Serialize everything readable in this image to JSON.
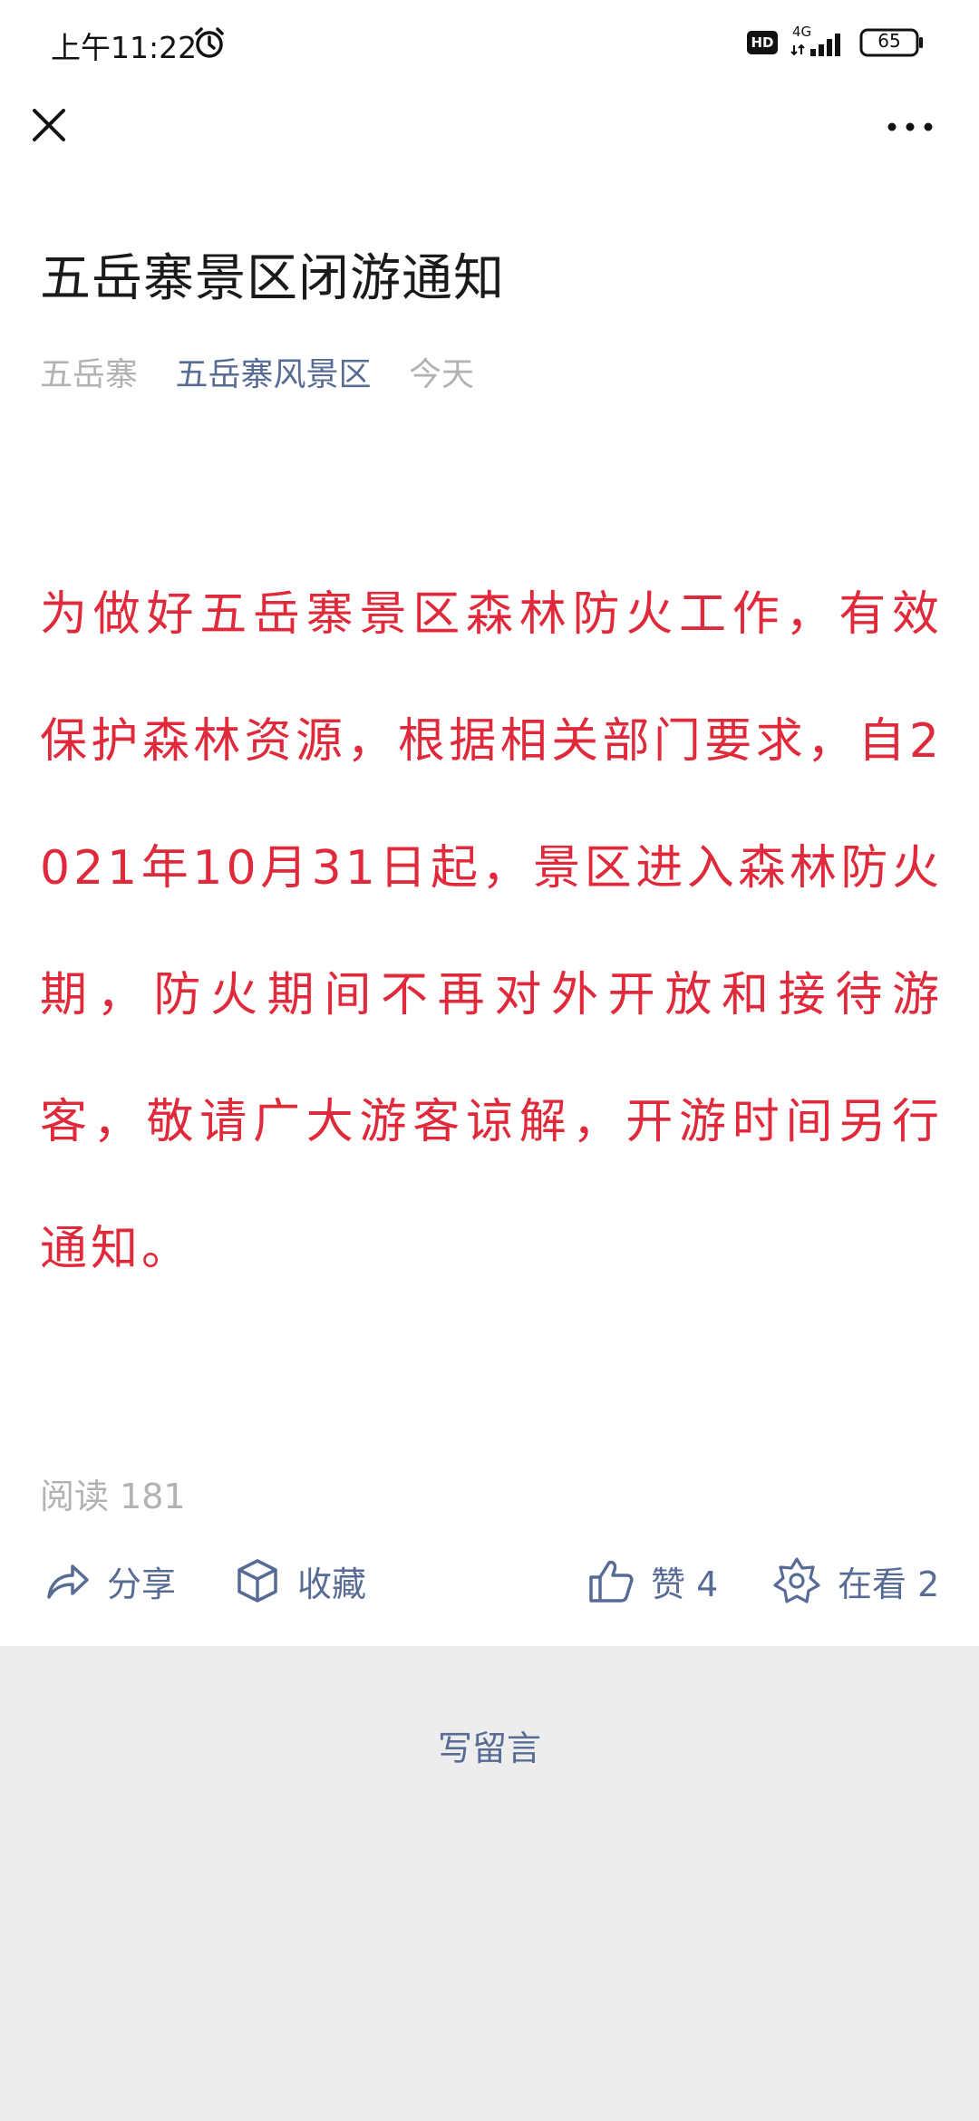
{
  "status_bar": {
    "time": "上午11:22",
    "hd": "HD",
    "network": "4G",
    "battery": "65",
    "icons": [
      "alarm-icon",
      "signal-icon",
      "battery-icon"
    ]
  },
  "nav": {
    "close_icon": "close-icon",
    "more_icon": "more-icon"
  },
  "article": {
    "title": "五岳寨景区闭游通知",
    "author": "五岳寨",
    "account": "五岳寨风景区",
    "date": "今天",
    "body": "为做好五岳寨景区森林防火工作，有效保护森林资源，根据相关部门要求，自2021年10月31日起，景区进入森林防火期，防火期间不再对外开放和接待游客，敬请广大游客谅解，开游时间另行通知。",
    "read_count": "阅读 181"
  },
  "actions": {
    "share": "分享",
    "collect": "收藏",
    "like": "赞 4",
    "watching": "在看 2"
  },
  "comment": {
    "write_label": "写留言"
  },
  "colors": {
    "body_text": "#e0293a",
    "link_blue": "#576b95",
    "meta_gray": "#b2b2b2",
    "comment_bg": "#ededed"
  }
}
